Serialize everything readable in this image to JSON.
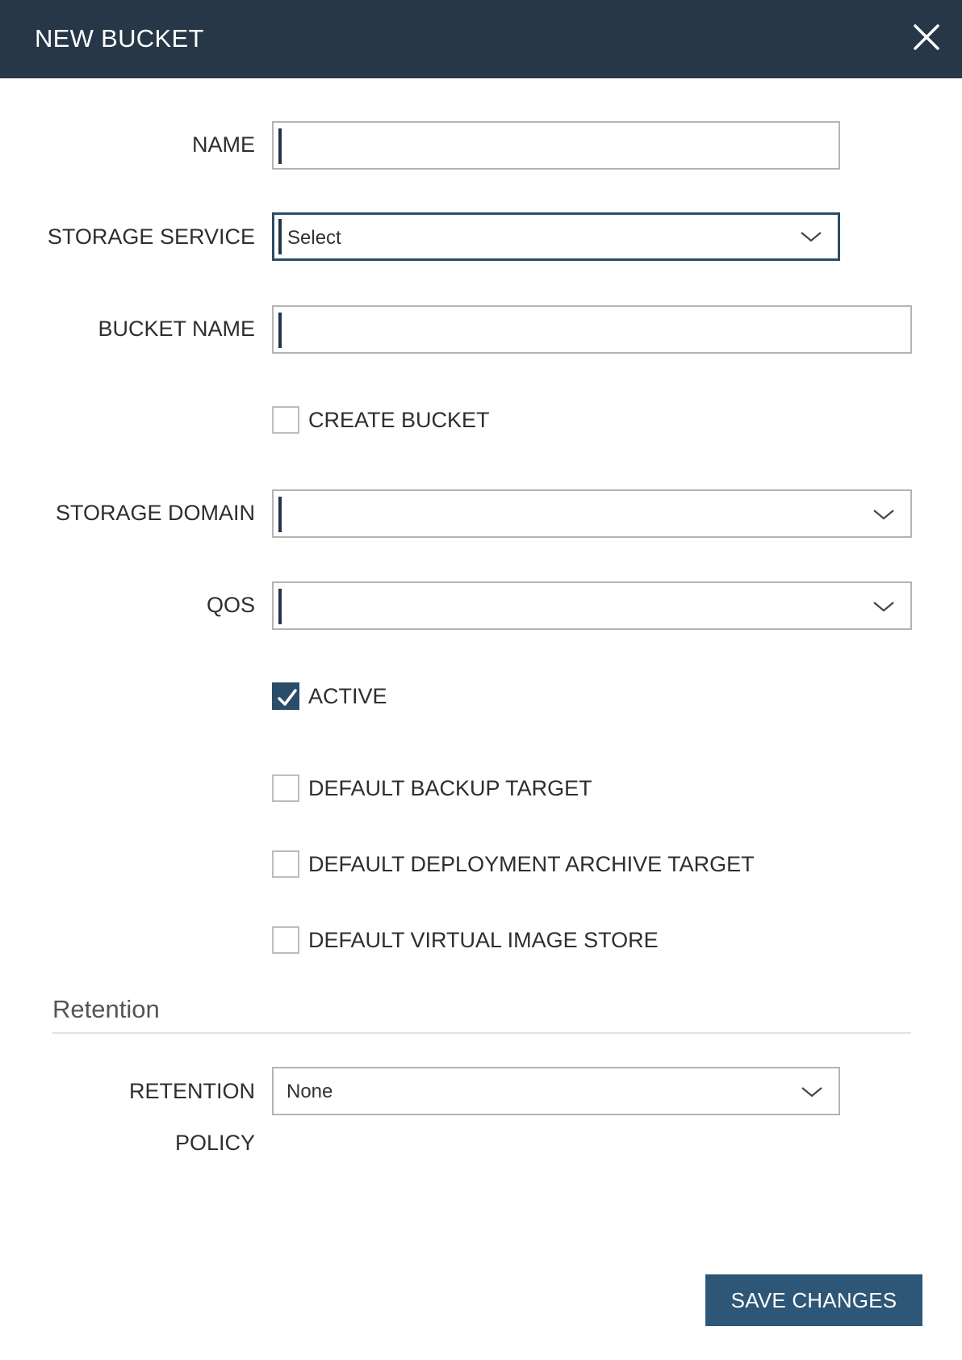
{
  "dialog": {
    "title": "NEW BUCKET"
  },
  "form": {
    "name": {
      "label": "NAME",
      "value": ""
    },
    "storage_service": {
      "label": "STORAGE SERVICE",
      "value": "Select"
    },
    "bucket_name": {
      "label": "BUCKET NAME",
      "value": ""
    },
    "create_bucket": {
      "label": "CREATE BUCKET",
      "checked": false
    },
    "storage_domain": {
      "label": "STORAGE DOMAIN",
      "value": ""
    },
    "qos": {
      "label": "QOS",
      "value": ""
    },
    "active": {
      "label": "ACTIVE",
      "checked": true
    },
    "default_backup_target": {
      "label": "DEFAULT BACKUP TARGET",
      "checked": false
    },
    "default_deployment_archive_target": {
      "label": "DEFAULT DEPLOYMENT ARCHIVE TARGET",
      "checked": false
    },
    "default_virtual_image_store": {
      "label": "DEFAULT VIRTUAL IMAGE STORE",
      "checked": false
    }
  },
  "retention": {
    "section_title": "Retention",
    "policy_label_line1": "RETENTION",
    "policy_label_line2": "POLICY",
    "policy_value": "None"
  },
  "footer": {
    "save_label": "SAVE CHANGES"
  },
  "icons": {
    "close": "close-icon",
    "chevron": "chevron-down-icon",
    "check": "checkmark-icon"
  },
  "colors": {
    "header_bg": "#273747",
    "accent": "#2a4d69",
    "save_button": "#2e5677"
  }
}
